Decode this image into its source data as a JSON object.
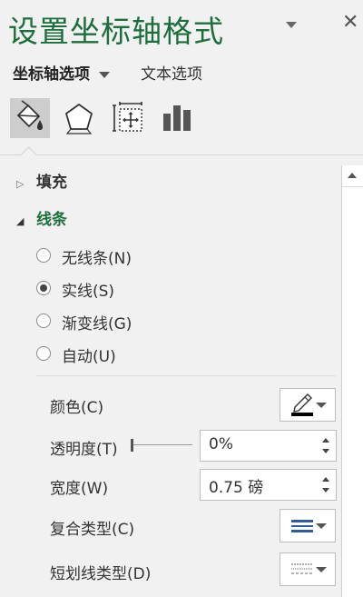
{
  "pane": {
    "title": "设置坐标轴格式",
    "title_dropdown_icon": "caret-down-icon",
    "close_icon": "close-icon"
  },
  "tabs": {
    "axis_options_label": "坐标轴选项",
    "text_options_label": "文本选项"
  },
  "icon_bar": [
    {
      "name": "fill-line-icon",
      "active": true
    },
    {
      "name": "effects-pentagon-icon",
      "active": false
    },
    {
      "name": "size-properties-icon",
      "active": false
    },
    {
      "name": "axis-options-chart-icon",
      "active": false
    }
  ],
  "sections": {
    "fill_label": "填充",
    "line_label": "线条"
  },
  "line_options": [
    {
      "label": "无线条(N)",
      "checked": false
    },
    {
      "label": "实线(S)",
      "checked": true
    },
    {
      "label": "渐变线(G)",
      "checked": false
    },
    {
      "label": "自动(U)",
      "checked": false
    }
  ],
  "properties": {
    "color_label": "颜色(C)",
    "transparency_label": "透明度(T)",
    "transparency_value": "0%",
    "transparency_slider": 0,
    "width_label": "宽度(W)",
    "width_value": "0.75 磅",
    "compound_label": "复合类型(C)",
    "dash_label": "短划线类型(D)"
  },
  "colors": {
    "accent": "#1e6d3c",
    "pane_bg": "#f1f1f1",
    "line_color": "#000000"
  }
}
